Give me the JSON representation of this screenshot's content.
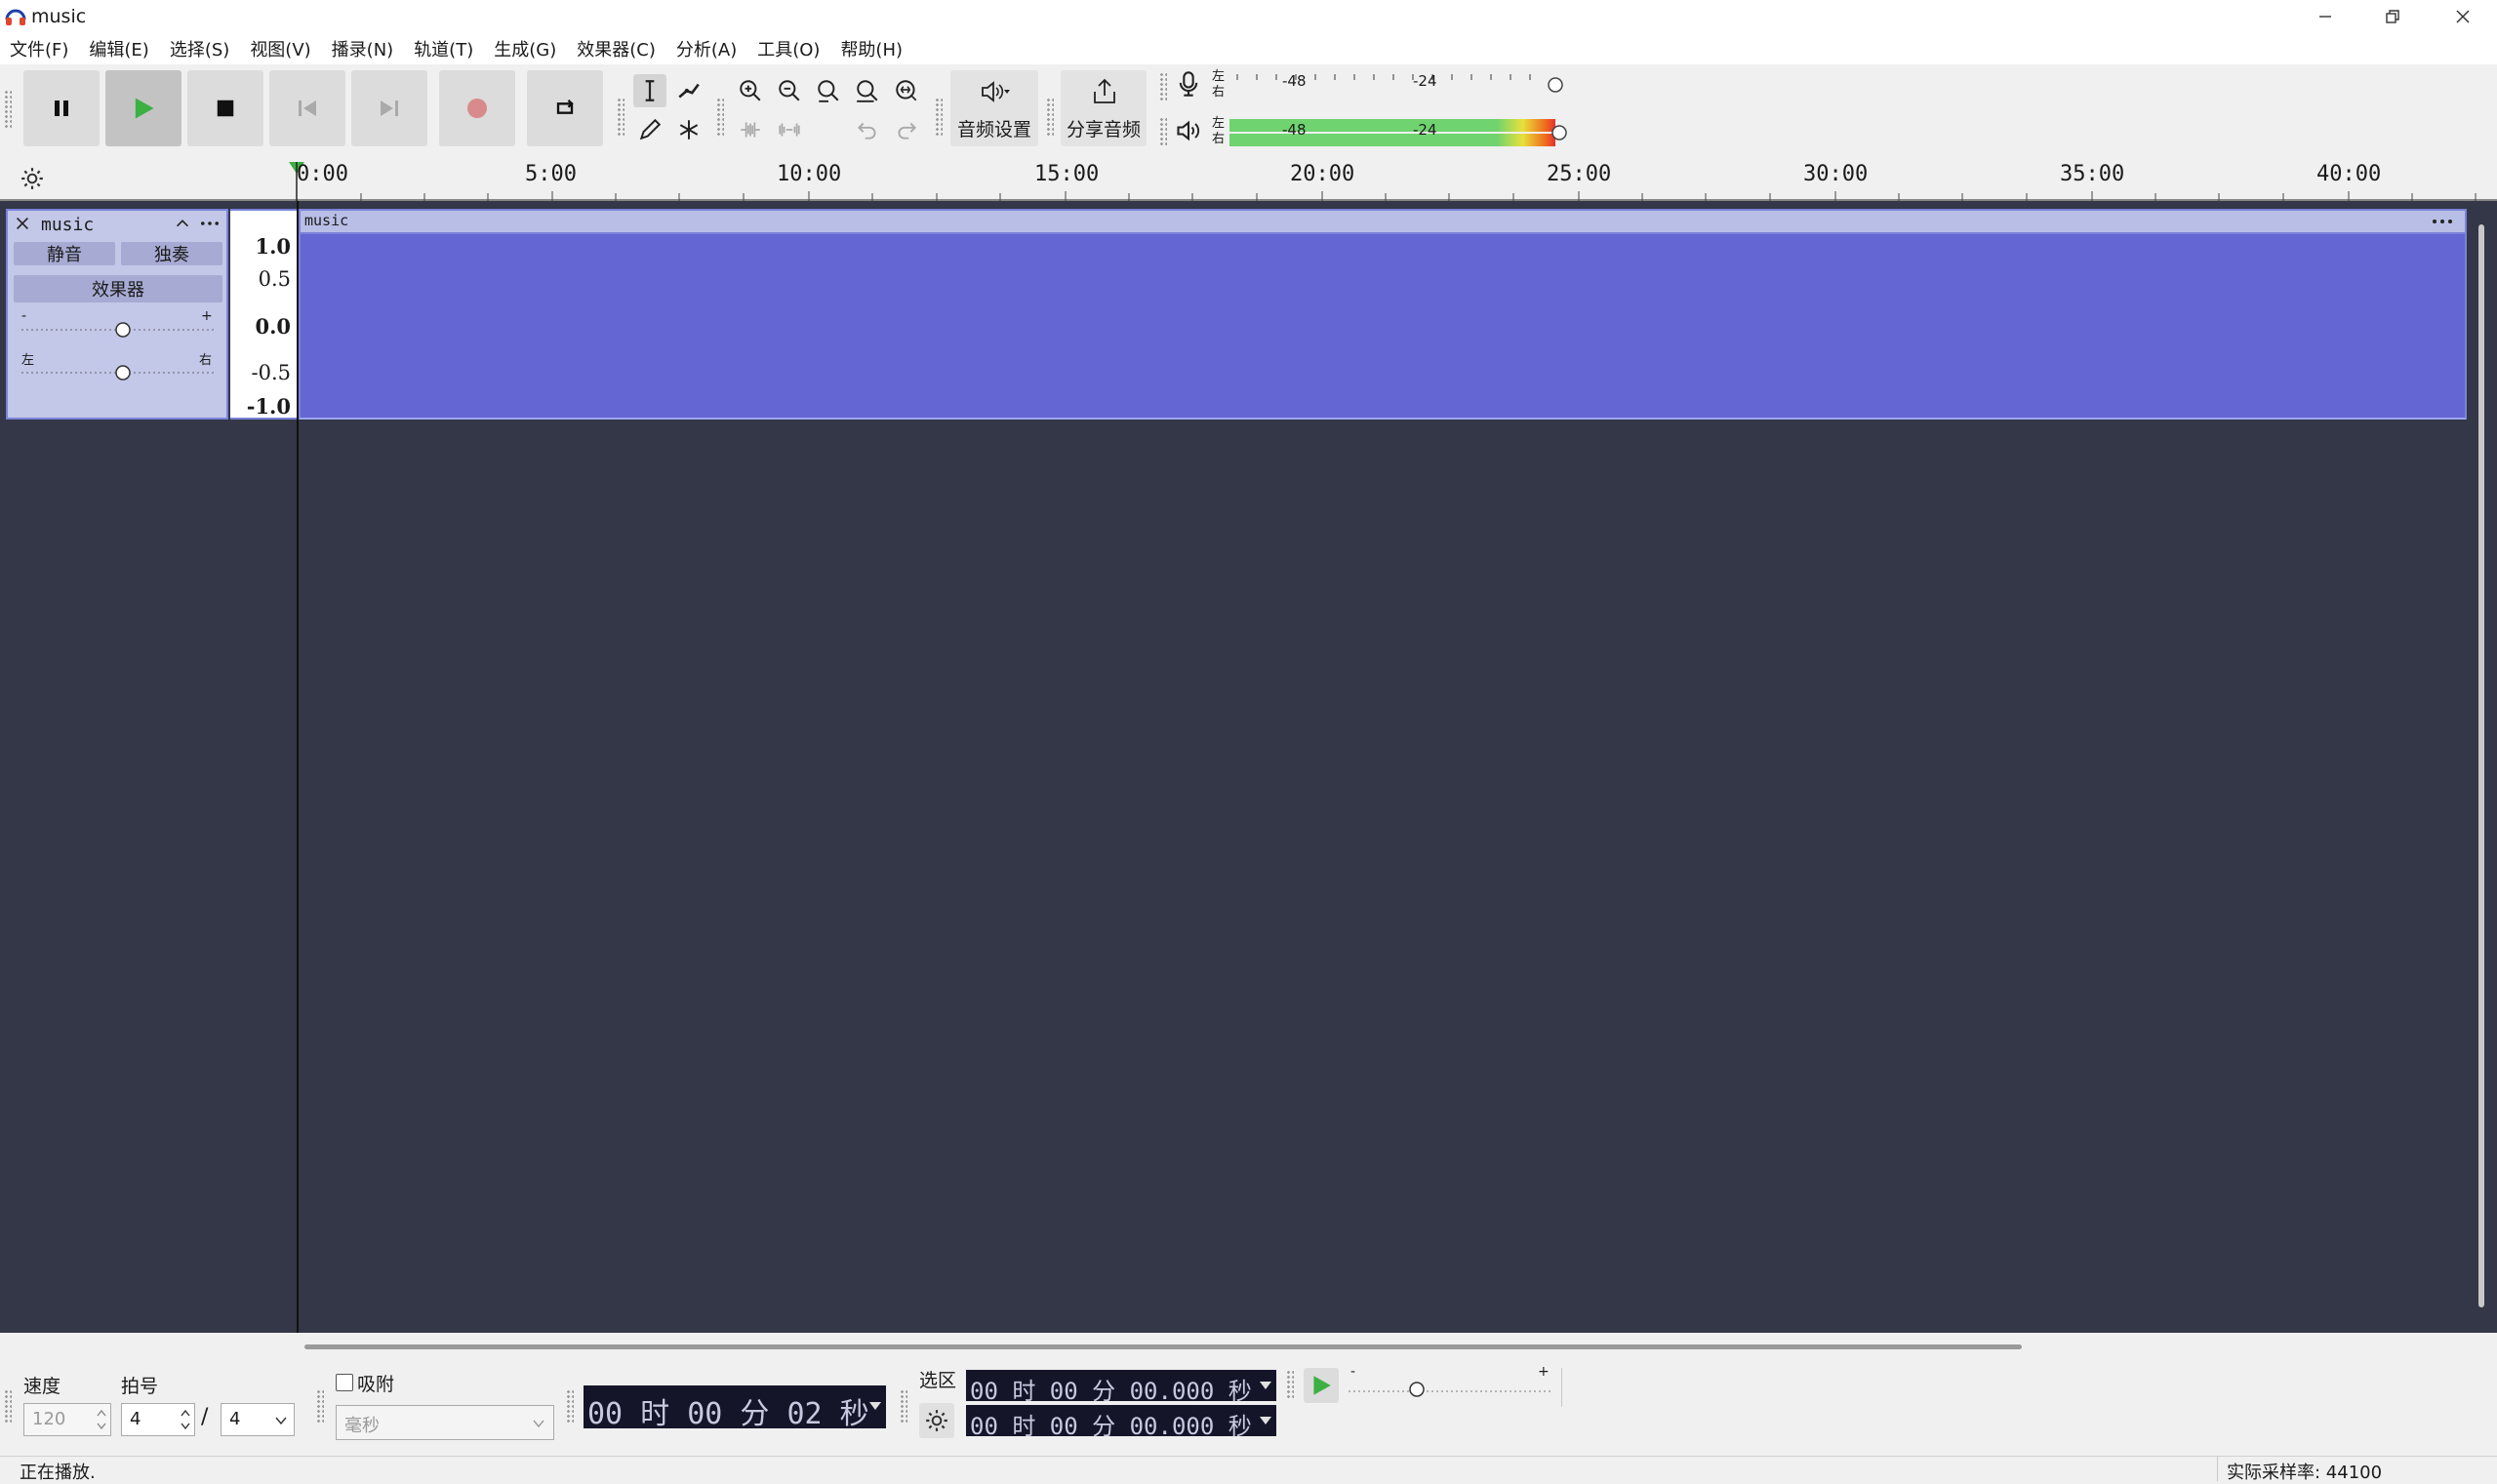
{
  "window": {
    "title": "music"
  },
  "menu": [
    "文件(F)",
    "编辑(E)",
    "选择(S)",
    "视图(V)",
    "播录(N)",
    "轨道(T)",
    "生成(G)",
    "效果器(C)",
    "分析(A)",
    "工具(O)",
    "帮助(H)"
  ],
  "toolbar": {
    "audio_setup_label": "音频设置",
    "share_audio_label": "分享音频",
    "meter_left": "左",
    "meter_right": "右",
    "meter_ticks": [
      "-48",
      "-24"
    ]
  },
  "ruler": {
    "labels": [
      "0:00",
      "5:00",
      "10:00",
      "15:00",
      "20:00",
      "25:00",
      "30:00",
      "35:00",
      "40:00"
    ]
  },
  "track": {
    "name": "music",
    "mute_label": "静音",
    "solo_label": "独奏",
    "effects_label": "效果器",
    "gain_minus": "-",
    "gain_plus": "+",
    "pan_left": "左",
    "pan_right": "右",
    "scale": [
      "1.0",
      "0.5",
      "0.0",
      "-0.5",
      "-1.0"
    ],
    "clip_name": "music"
  },
  "bottom": {
    "tempo_label": "速度",
    "tempo_value": "120",
    "meter_label": "拍号",
    "beats_value": "4",
    "slash": "/",
    "beat_unit_value": "4",
    "snap_label": "吸附",
    "snap_unit": "毫秒",
    "time_display": "00 时 00 分 02 秒",
    "selection_label": "选区",
    "selection_start": "00 时 00 分 00.000 秒",
    "selection_end": "00 时 00 分 00.000 秒",
    "speed_minus": "-",
    "speed_plus": "+"
  },
  "status": {
    "left": "正在播放.",
    "right": "实际采样率: 44100"
  },
  "colors": {
    "track_bg": "#333747",
    "clip": "#6466d3",
    "clip_header": "#b9bee6",
    "selection_border": "#7b83d8",
    "play_green": "#3cb043",
    "record_red": "#cc3333"
  }
}
